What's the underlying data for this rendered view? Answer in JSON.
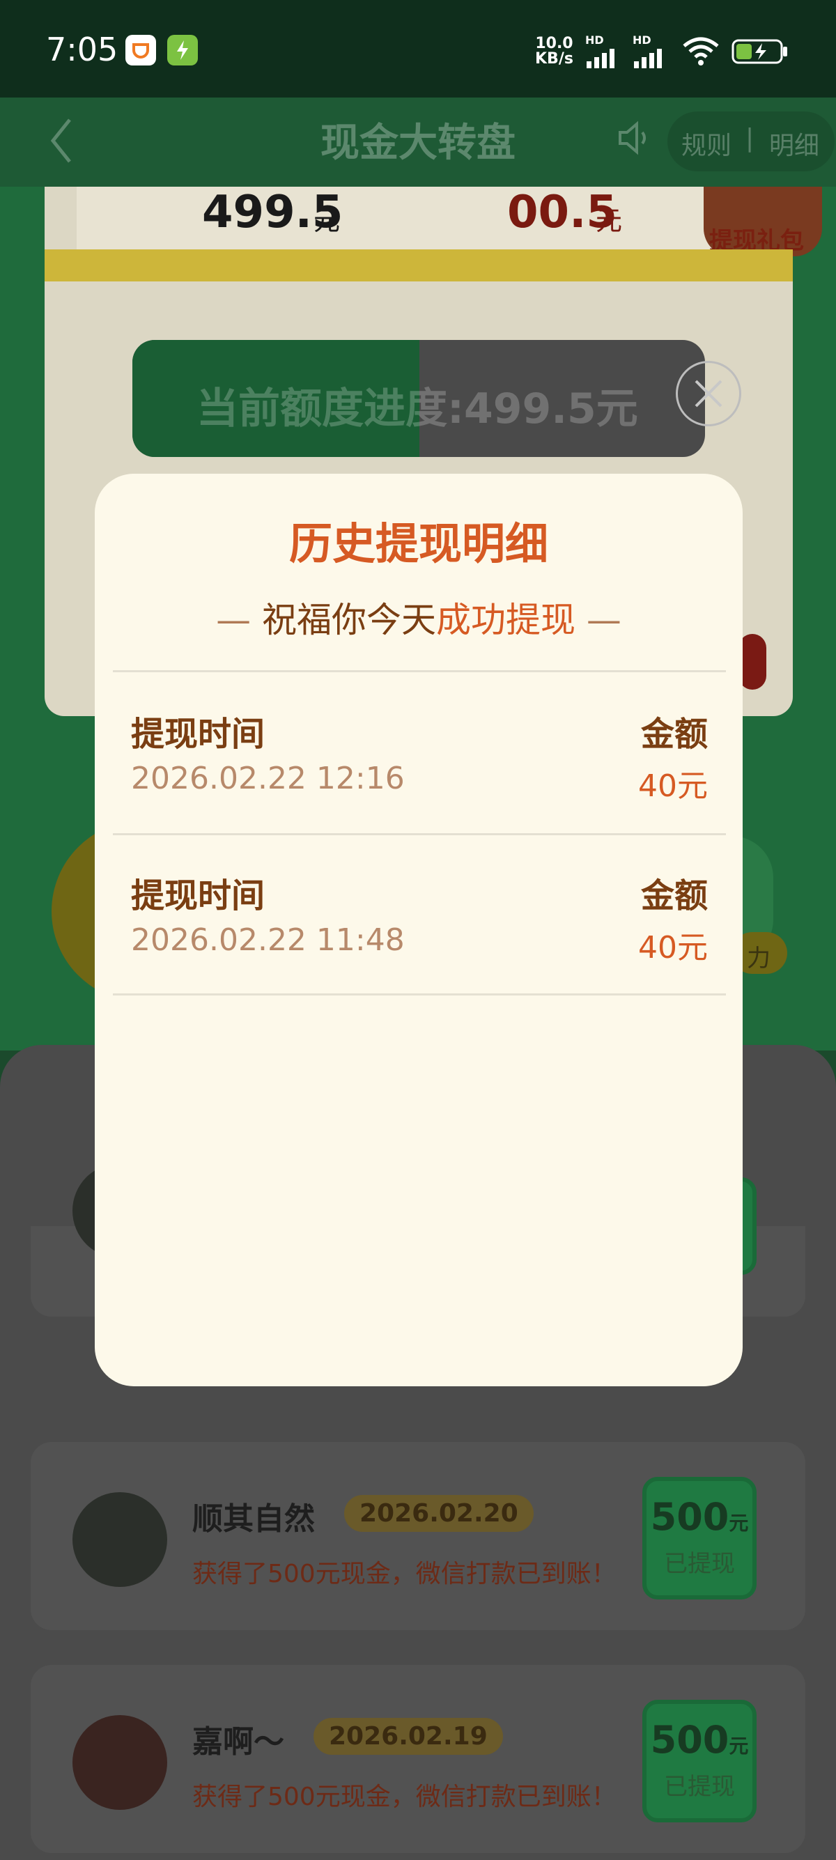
{
  "status_bar": {
    "time": "7:05",
    "net_speed_value": "10.0",
    "net_speed_unit": "KB/s",
    "hd1": "HD",
    "hd2": "HD"
  },
  "nav": {
    "title": "现金大转盘",
    "rules": "规则",
    "detail": "明细",
    "separator": "|"
  },
  "background": {
    "amount_left_value": "499.5",
    "amount_left_unit": "元",
    "amount_right_value": "00.5",
    "amount_right_unit": "元",
    "gift_label": "提现礼包",
    "progress_text": "当前额度进度:499.5元",
    "side_text": "力",
    "list": [
      {
        "name": "顺其自然",
        "date": "2026.02.20",
        "desc": "获得了500元现金，微信打款已到账！",
        "badge_amount": "500",
        "badge_unit": "元",
        "badge_status": "已提现"
      },
      {
        "name": "嘉啊～",
        "date": "2026.02.19",
        "desc": "获得了500元现金，微信打款已到账！",
        "badge_amount": "500",
        "badge_unit": "元",
        "badge_status": "已提现"
      }
    ]
  },
  "modal": {
    "title": "历史提现明细",
    "subtitle_prefix": "祝福你今天",
    "subtitle_highlight": "成功提现",
    "dash_left": "—",
    "dash_right": "—",
    "records": [
      {
        "time_label": "提现时间",
        "time": "2026.02.22 12:16",
        "amount_label": "金额",
        "amount": "40元"
      },
      {
        "time_label": "提现时间",
        "time": "2026.02.22 11:48",
        "amount_label": "金额",
        "amount": "40元"
      }
    ]
  },
  "colors": {
    "accent": "#d65a23",
    "modal_bg": "#fdf9ea",
    "brand_green": "#1f6b3c"
  }
}
